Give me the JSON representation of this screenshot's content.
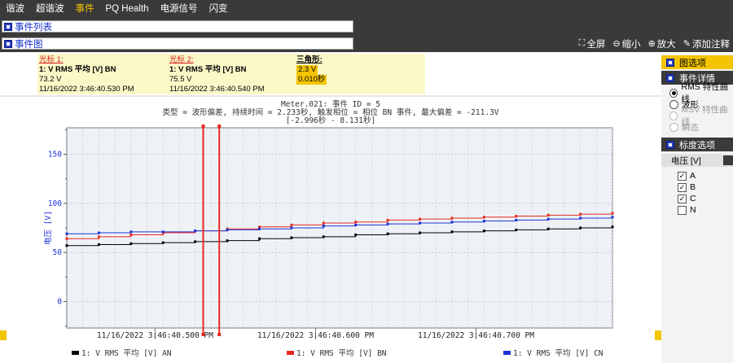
{
  "menu": {
    "items": [
      {
        "label": "谐波",
        "active": false
      },
      {
        "label": "超谐波",
        "active": false
      },
      {
        "label": "事件",
        "active": true
      },
      {
        "label": "PQ Health",
        "active": false
      },
      {
        "label": "电源信号",
        "active": false
      },
      {
        "label": "闪变",
        "active": false
      }
    ]
  },
  "event_list": {
    "title": "事件列表"
  },
  "event_chart_section": {
    "title": "事件图",
    "toolbar": {
      "fullscreen": "全屏",
      "zoom_out": "缩小",
      "zoom_in": "放大",
      "add_note": "添加注释"
    }
  },
  "cursor1": {
    "title": "光标 1:",
    "channel": "1: V RMS 平均 [V] BN",
    "value": "73.2 V",
    "time": "11/16/2022 3:46:40.530 PM"
  },
  "cursor2": {
    "title": "光标 2:",
    "channel": "1: V RMS 平均 [V] BN",
    "value": "75.5 V",
    "time": "11/16/2022 3:46:40.540 PM"
  },
  "triangle": {
    "title": "三角形:",
    "value": "2.3 V",
    "time": "0.010秒"
  },
  "chart_header": {
    "line1": "Meter.021: 事件 ID = 5",
    "line2": "类型 = 波形偏差, 持续时间 = 2.233秒, 触发相位 = 相位 BN 事件, 最大偏差 = -211.3V",
    "line3": "[-2.996秒 - 8.131秒]"
  },
  "chart_data": {
    "type": "line",
    "ylabel": "电压 [V]",
    "ylim": [
      -27,
      177
    ],
    "yticks": [
      "150",
      "100",
      "50",
      "0"
    ],
    "x_tick_labels": [
      "11/16/2022 3:46:40.500 PM",
      "11/16/2022 3:46:40.600 PM",
      "11/16/2022 3:46:40.700 PM"
    ],
    "x_ms": [
      445,
      785
    ],
    "x_tick_ms": [
      500,
      600,
      700
    ],
    "cursors_ms": [
      530,
      540
    ],
    "grid": true,
    "legend_position": "bottom",
    "series": [
      {
        "name": "1: V RMS 平均 [V] AN",
        "color": "#000000",
        "points": [
          [
            445,
            57
          ],
          [
            465,
            58
          ],
          [
            485,
            59
          ],
          [
            505,
            60
          ],
          [
            525,
            61
          ],
          [
            545,
            62
          ],
          [
            565,
            64
          ],
          [
            585,
            65
          ],
          [
            605,
            66
          ],
          [
            625,
            68
          ],
          [
            645,
            69
          ],
          [
            665,
            70
          ],
          [
            685,
            71
          ],
          [
            705,
            72
          ],
          [
            725,
            73
          ],
          [
            745,
            74
          ],
          [
            765,
            75
          ],
          [
            785,
            76
          ]
        ]
      },
      {
        "name": "1: V RMS 平均 [V] BN",
        "color": "#e8281e",
        "points": [
          [
            445,
            64
          ],
          [
            465,
            66
          ],
          [
            485,
            68
          ],
          [
            505,
            70
          ],
          [
            525,
            72
          ],
          [
            545,
            74
          ],
          [
            565,
            76
          ],
          [
            585,
            78
          ],
          [
            605,
            80
          ],
          [
            625,
            81
          ],
          [
            645,
            83
          ],
          [
            665,
            84
          ],
          [
            685,
            85
          ],
          [
            705,
            86
          ],
          [
            725,
            87
          ],
          [
            745,
            88
          ],
          [
            765,
            89
          ],
          [
            785,
            90
          ]
        ]
      },
      {
        "name": "1: V RMS 平均 [V] CN",
        "color": "#1c31d6",
        "points": [
          [
            445,
            69
          ],
          [
            465,
            70
          ],
          [
            485,
            71
          ],
          [
            505,
            71
          ],
          [
            525,
            72
          ],
          [
            545,
            73
          ],
          [
            565,
            74
          ],
          [
            585,
            75
          ],
          [
            605,
            77
          ],
          [
            625,
            78
          ],
          [
            645,
            79
          ],
          [
            665,
            80
          ],
          [
            685,
            81
          ],
          [
            705,
            82
          ],
          [
            725,
            83
          ],
          [
            745,
            84
          ],
          [
            765,
            85
          ],
          [
            785,
            86
          ]
        ]
      }
    ]
  },
  "right_panel": {
    "graph_options": "图选项",
    "event_details": "事件详情",
    "radios": [
      {
        "label": "RMS 特性曲线",
        "checked": true,
        "disabled": false
      },
      {
        "label": "波形",
        "checked": false,
        "disabled": false
      },
      {
        "label": "MSV 特性曲线",
        "checked": false,
        "disabled": true
      },
      {
        "label": "瞬态",
        "checked": false,
        "disabled": true
      }
    ],
    "scale_options": "标度选项",
    "voltage_label": "电压 [V]",
    "phases": [
      {
        "label": "A",
        "checked": true
      },
      {
        "label": "B",
        "checked": true
      },
      {
        "label": "C",
        "checked": true
      },
      {
        "label": "N",
        "checked": false
      }
    ]
  },
  "colors": {
    "accent": "#f3c400",
    "dark": "#3a3a3a",
    "link_blue": "#1330c8"
  }
}
